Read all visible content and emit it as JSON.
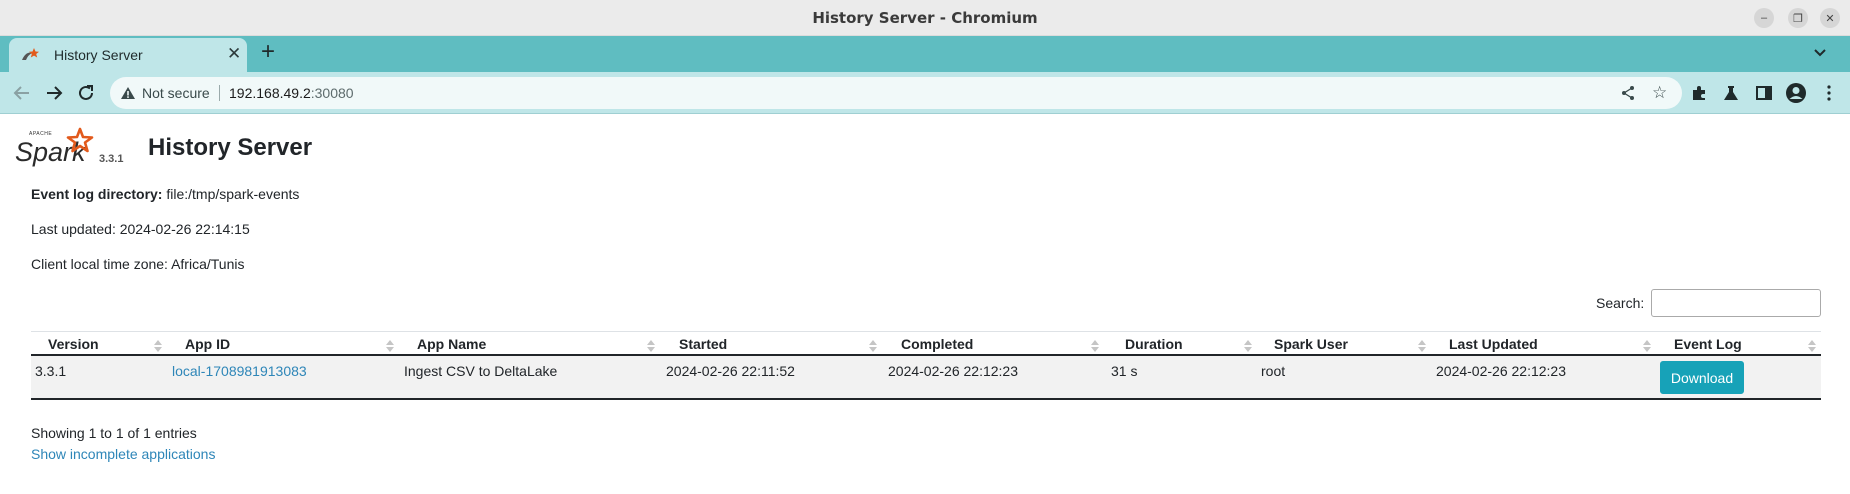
{
  "window": {
    "title": "History Server - Chromium",
    "controls": {
      "minimize": "–",
      "maximize": "❐",
      "close": "✕"
    }
  },
  "browser": {
    "tab": {
      "title": "History Server",
      "close": "✕"
    },
    "new_tab": "+",
    "address": {
      "security_label": "Not secure",
      "host": "192.168.49.2",
      "port": ":30080"
    }
  },
  "page": {
    "logo_text": "Spark",
    "spark_version": "3.3.1",
    "title": "History Server",
    "event_log_label": "Event log directory:",
    "event_log_value": " file:/tmp/spark-events",
    "last_updated": "Last updated: 2024-02-26 22:14:15",
    "timezone": "Client local time zone: Africa/Tunis",
    "search_label": "Search:",
    "search_value": "",
    "table": {
      "columns": [
        "Version",
        "App ID",
        "App Name",
        "Started",
        "Completed",
        "Duration",
        "Spark User",
        "Last Updated",
        "Event Log"
      ],
      "rows": [
        {
          "version": "3.3.1",
          "app_id": "local-1708981913083",
          "app_name": "Ingest CSV to DeltaLake",
          "started": "2024-02-26 22:11:52",
          "completed": "2024-02-26 22:12:23",
          "duration": "31 s",
          "spark_user": "root",
          "last_updated": "2024-02-26 22:12:23",
          "event_log": "Download"
        }
      ]
    },
    "showing": "Showing 1 to 1 of 1 entries",
    "incomplete_link": "Show incomplete applications"
  },
  "colors": {
    "accent_tab": "#5fbdc1",
    "toolbar": "#bfe6e8",
    "link": "#2e86b8",
    "button": "#17a2b8"
  }
}
